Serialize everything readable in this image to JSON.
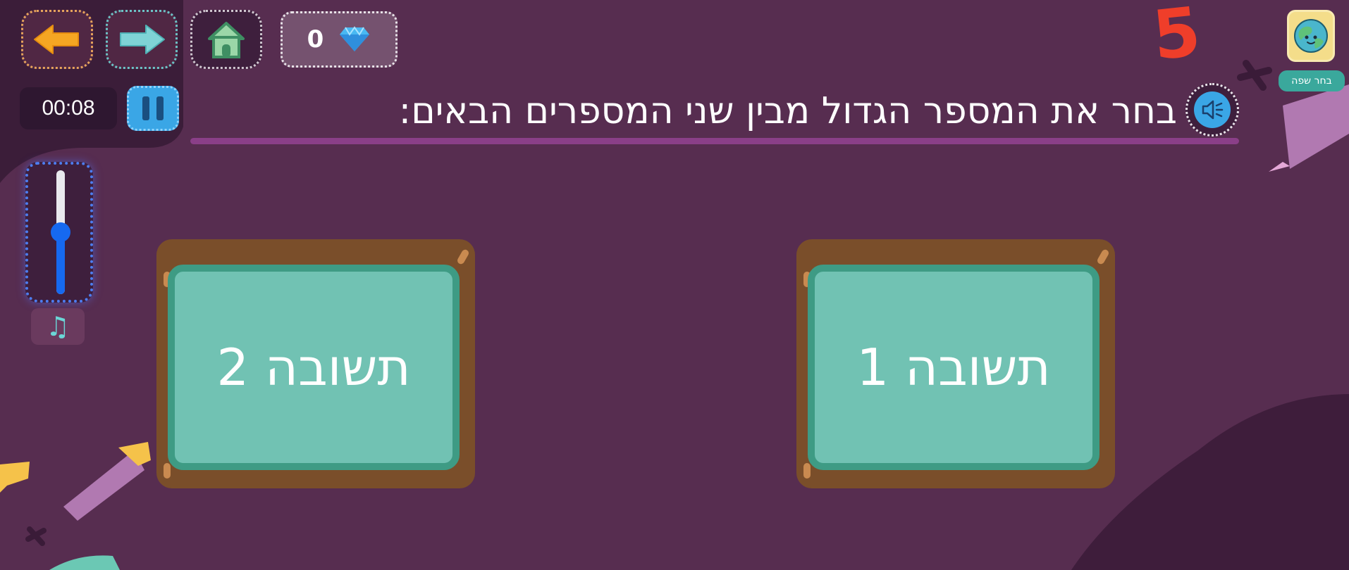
{
  "toolbar": {
    "back_icon": "arrow-left-icon",
    "forward_icon": "arrow-right-icon",
    "home_icon": "home-icon",
    "gems_count": "0",
    "gem_icon": "diamond-icon"
  },
  "timer": {
    "value": "00:08"
  },
  "question": {
    "text": "בחר את המספר הגדול מבין שני המספרים הבאים:",
    "speaker_icon": "speaker-icon"
  },
  "volume": {
    "level": 0.5,
    "music_icon": "music-note-icon"
  },
  "answers": [
    {
      "label": "תשובה 1"
    },
    {
      "label": "תשובה 2"
    }
  ],
  "score": {
    "number": "5"
  },
  "language": {
    "label": "בחר שפה",
    "icon": "globe-icon"
  },
  "colors": {
    "background": "#572d50",
    "board_frame": "#7a4e2a",
    "board_surface": "#71c2b3",
    "accent_blue": "#3aa6e6",
    "score_red": "#ef3e2a"
  }
}
